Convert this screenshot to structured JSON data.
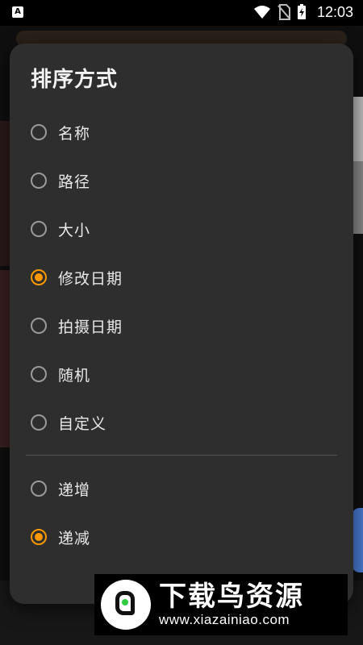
{
  "status_bar": {
    "app_icon_label": "A",
    "time": "12:03"
  },
  "dialog": {
    "title": "排序方式",
    "sort_options": [
      {
        "label": "名称",
        "selected": false
      },
      {
        "label": "路径",
        "selected": false
      },
      {
        "label": "大小",
        "selected": false
      },
      {
        "label": "修改日期",
        "selected": true
      },
      {
        "label": "拍摄日期",
        "selected": false
      },
      {
        "label": "随机",
        "selected": false
      },
      {
        "label": "自定义",
        "selected": false
      }
    ],
    "order_options": [
      {
        "label": "递增",
        "selected": false
      },
      {
        "label": "递减",
        "selected": true
      }
    ]
  },
  "watermark": {
    "title": "下载鸟资源",
    "url": "www.xiazainiao.com"
  },
  "colors": {
    "accent": "#ff9800",
    "dialog_bg": "#2e2e2e",
    "text": "#e8e8e8"
  }
}
